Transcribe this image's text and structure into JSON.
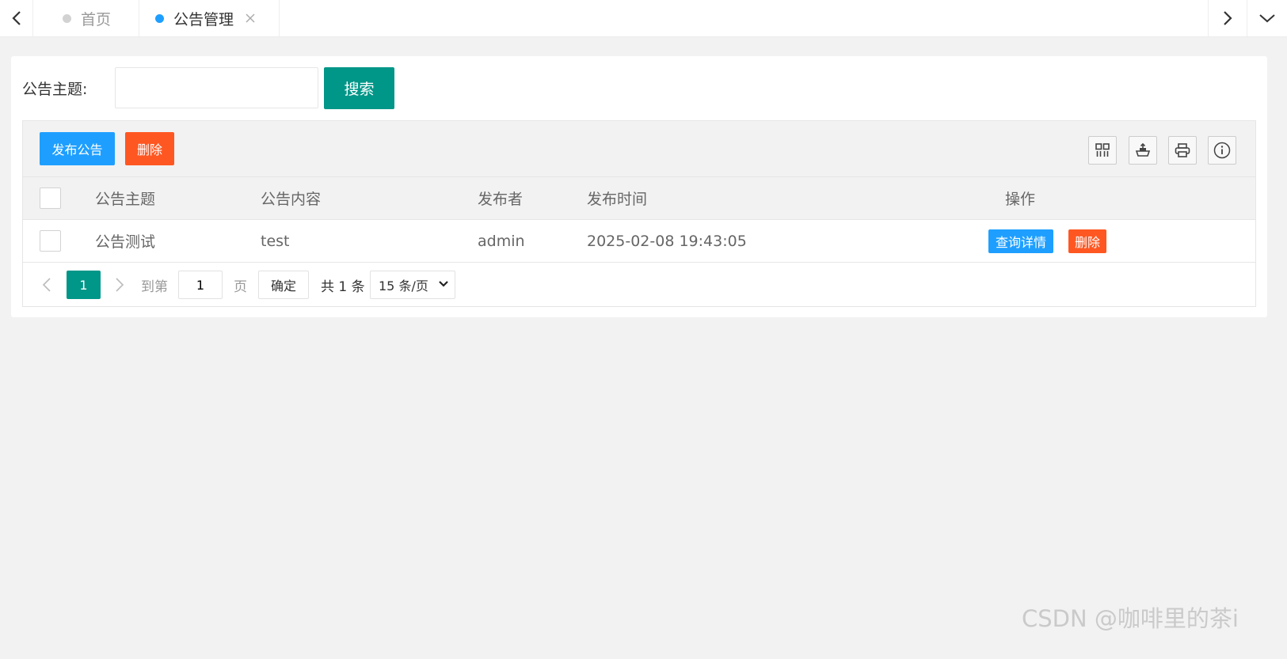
{
  "tabs": {
    "home_label": "首页",
    "notice_label": "公告管理"
  },
  "search": {
    "label": "公告主题:",
    "value": "",
    "button_label": "搜索"
  },
  "toolbar": {
    "publish_label": "发布公告",
    "delete_label": "删除",
    "icons": [
      "columns-icon",
      "export-icon",
      "print-icon",
      "info-icon"
    ]
  },
  "table": {
    "columns": [
      "公告主题",
      "公告内容",
      "发布者",
      "发布时间",
      "操作"
    ],
    "rows": [
      {
        "title": "公告测试",
        "content": "test",
        "author": "admin",
        "time": "2025-02-08 19:43:05",
        "detail_label": "查询详情",
        "delete_label": "删除"
      }
    ]
  },
  "pager": {
    "current_page": "1",
    "goto_label": "到第",
    "goto_value": "1",
    "page_label": "页",
    "confirm_label": "确定",
    "total_label": "共 1 条",
    "page_size_label": "15 条/页"
  },
  "watermark": "CSDN @咖啡里的茶i",
  "colors": {
    "primary_teal": "#009688",
    "blue": "#1e9fff",
    "danger": "#ff5722",
    "background": "#f2f2f2"
  }
}
